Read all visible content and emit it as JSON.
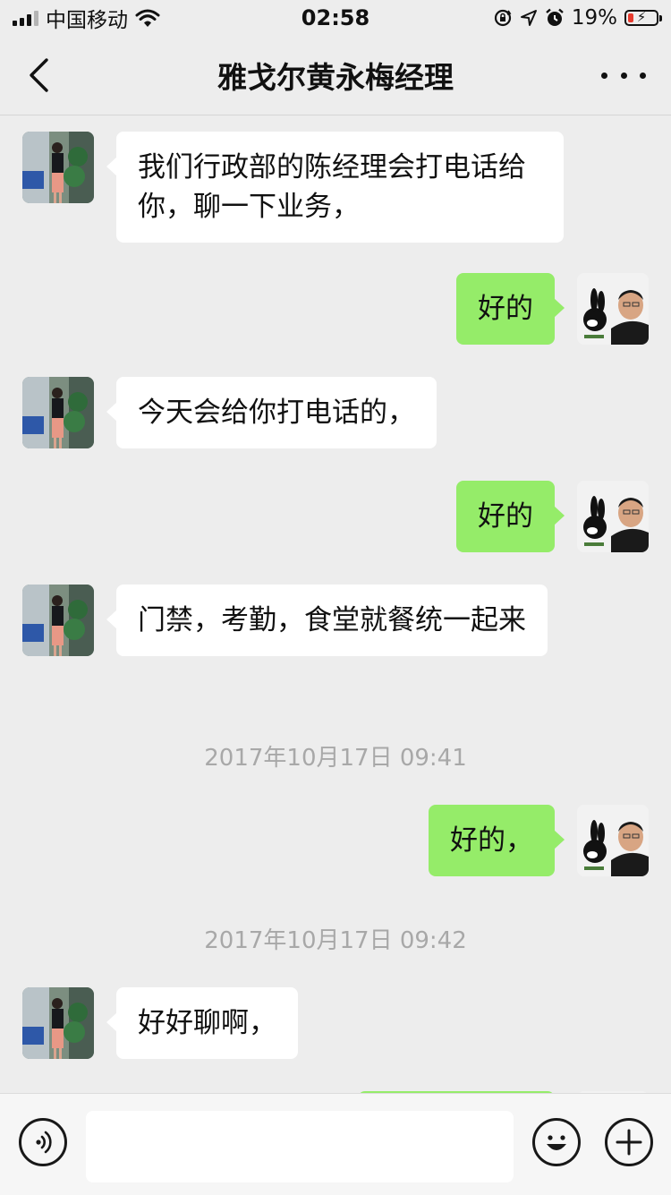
{
  "status_bar": {
    "carrier": "中国移动",
    "time": "02:58",
    "battery_percent": "19%",
    "icons": [
      "signal-icon",
      "wifi-icon",
      "rotation-lock-icon",
      "location-icon",
      "alarm-icon",
      "battery-charging-icon"
    ]
  },
  "header": {
    "title": "雅戈尔黄永梅经理",
    "back_icon": "chevron-left-icon",
    "more_icon": "ellipsis-icon"
  },
  "messages": [
    {
      "from": "contact",
      "text": "我们行政部的陈经理会打电话给你，聊一下业务，"
    },
    {
      "from": "me",
      "text": "好的"
    },
    {
      "from": "contact",
      "text": "今天会给你打电话的，"
    },
    {
      "from": "me",
      "text": "好的"
    },
    {
      "from": "contact",
      "text": "门禁，考勤，食堂就餐统一起来"
    },
    {
      "timestamp": "2017年10月17日 09:41"
    },
    {
      "from": "me",
      "text": "好的，"
    },
    {
      "timestamp": "2017年10月17日 09:42"
    },
    {
      "from": "contact",
      "text": "好好聊啊，"
    }
  ],
  "input_bar": {
    "placeholder": "",
    "icons": [
      "voice-icon",
      "emoji-icon",
      "plus-icon"
    ]
  },
  "colors": {
    "background": "#ededed",
    "incoming_bubble": "#ffffff",
    "outgoing_bubble": "#95ec69",
    "timestamp_text": "#a8a8a8"
  }
}
